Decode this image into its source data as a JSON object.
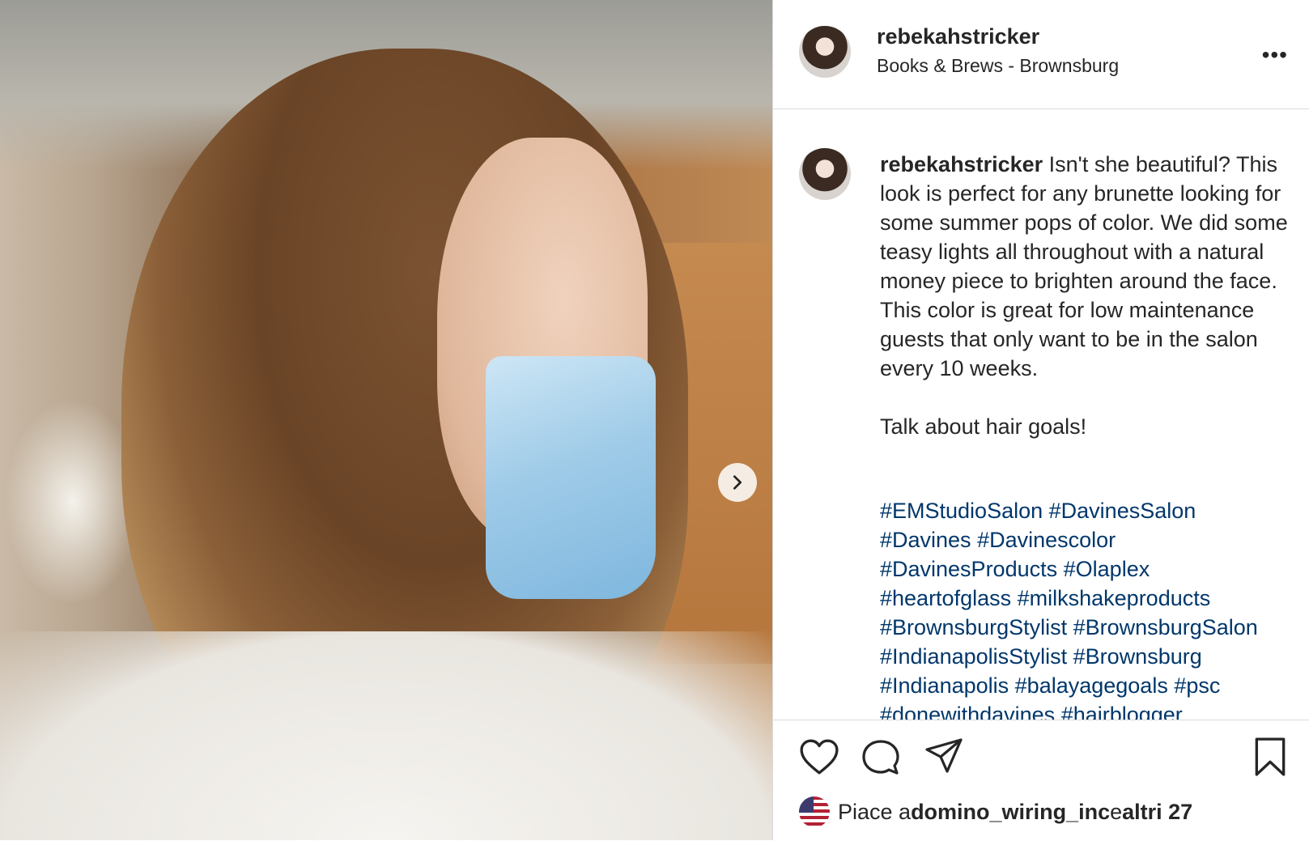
{
  "post": {
    "username": "rebekahstricker",
    "location": "Books & Brews - Brownsburg",
    "more_label": "•••"
  },
  "caption": {
    "username": "rebekahstricker",
    "line1": " Isn't she beautiful? This look is perfect for any brunette looking for some summer pops of color. We did some teasy lights all throughout with a natural money piece to brighten around the face. This color is great for low maintenance guests that only want to be in the salon every 10 weeks.",
    "line2": "Talk about hair goals!",
    "hashtags": [
      "#EMStudioSalon",
      "#DavinesSalon",
      "#Davines",
      "#Davinescolor",
      "#DavinesProducts",
      "#Olaplex",
      "#heartofglass",
      "#milkshakeproducts",
      "#BrownsburgStylist",
      "#BrownsburgSalon",
      "#IndianapolisStylist",
      "#Brownsburg",
      "#Indianapolis",
      "#balayagegoals",
      "#psc",
      "#donewithdavines",
      "#hairblogger"
    ]
  },
  "likes": {
    "prefix": "Piace a ",
    "user": "domino_wiring_inc",
    "middle": " e ",
    "others": "altri 27"
  },
  "icons": {
    "like": "heart-icon",
    "comment": "comment-icon",
    "share": "send-icon",
    "save": "bookmark-icon",
    "next": "chevron-right-icon"
  },
  "colors": {
    "hashtag": "#00376b",
    "border": "#dbdbdb",
    "text": "#262626"
  }
}
